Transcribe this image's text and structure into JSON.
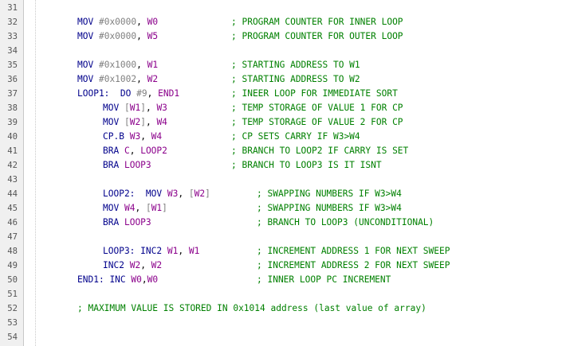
{
  "theme": {
    "comment_color": "#008000",
    "keyword_color": "#00008b",
    "register_color": "#8b008b",
    "number_color": "#808080",
    "gutter_bg": "#f0f0f0"
  },
  "editor": {
    "lines": [
      {
        "no": "31",
        "indent": 0,
        "tokens": []
      },
      {
        "no": "32",
        "indent": 0,
        "tokens": [
          {
            "t": "kw",
            "v": "MOV"
          },
          {
            "t": "txt",
            "v": " "
          },
          {
            "t": "num",
            "v": "#0x0000"
          },
          {
            "t": "txt",
            "v": ", "
          },
          {
            "t": "reg",
            "v": "W0"
          }
        ],
        "comment": "; PROGRAM COUNTER FOR INNER LOOP",
        "ccol": 290
      },
      {
        "no": "33",
        "indent": 0,
        "tokens": [
          {
            "t": "kw",
            "v": "MOV"
          },
          {
            "t": "txt",
            "v": " "
          },
          {
            "t": "num",
            "v": "#0x0000"
          },
          {
            "t": "txt",
            "v": ", "
          },
          {
            "t": "reg",
            "v": "W5"
          }
        ],
        "comment": "; PROGRAM COUNTER FOR OUTER LOOP",
        "ccol": 290
      },
      {
        "no": "34",
        "indent": 0,
        "tokens": []
      },
      {
        "no": "35",
        "indent": 0,
        "tokens": [
          {
            "t": "kw",
            "v": "MOV"
          },
          {
            "t": "txt",
            "v": " "
          },
          {
            "t": "num",
            "v": "#0x1000"
          },
          {
            "t": "txt",
            "v": ", "
          },
          {
            "t": "reg",
            "v": "W1"
          }
        ],
        "comment": "; STARTING ADDRESS TO W1",
        "ccol": 290
      },
      {
        "no": "36",
        "indent": 0,
        "tokens": [
          {
            "t": "kw",
            "v": "MOV"
          },
          {
            "t": "txt",
            "v": " "
          },
          {
            "t": "num",
            "v": "#0x1002"
          },
          {
            "t": "txt",
            "v": ", "
          },
          {
            "t": "reg",
            "v": "W2"
          }
        ],
        "comment": "; STARTING ADDRESS TO W2",
        "ccol": 290
      },
      {
        "no": "37",
        "indent": 0,
        "tokens": [
          {
            "t": "lbl",
            "v": "LOOP1:"
          },
          {
            "t": "txt",
            "v": "  "
          },
          {
            "t": "kw",
            "v": "DO"
          },
          {
            "t": "txt",
            "v": " "
          },
          {
            "t": "num",
            "v": "#9"
          },
          {
            "t": "txt",
            "v": ", "
          },
          {
            "t": "reg",
            "v": "END1"
          }
        ],
        "comment": "; INEER LOOP FOR IMMEDIATE SORT",
        "ccol": 290
      },
      {
        "no": "38",
        "indent": 1,
        "tokens": [
          {
            "t": "kw",
            "v": "MOV"
          },
          {
            "t": "txt",
            "v": " "
          },
          {
            "t": "num",
            "v": "["
          },
          {
            "t": "reg",
            "v": "W1"
          },
          {
            "t": "num",
            "v": "]"
          },
          {
            "t": "txt",
            "v": ", "
          },
          {
            "t": "reg",
            "v": "W3"
          }
        ],
        "comment": "; TEMP STORAGE OF VALUE 1 FOR CP",
        "ccol": 290
      },
      {
        "no": "39",
        "indent": 1,
        "tokens": [
          {
            "t": "kw",
            "v": "MOV"
          },
          {
            "t": "txt",
            "v": " "
          },
          {
            "t": "num",
            "v": "["
          },
          {
            "t": "reg",
            "v": "W2"
          },
          {
            "t": "num",
            "v": "]"
          },
          {
            "t": "txt",
            "v": ", "
          },
          {
            "t": "reg",
            "v": "W4"
          }
        ],
        "comment": "; TEMP STORAGE OF VALUE 2 FOR CP",
        "ccol": 290
      },
      {
        "no": "40",
        "indent": 1,
        "tokens": [
          {
            "t": "kw",
            "v": "CP.B"
          },
          {
            "t": "txt",
            "v": " "
          },
          {
            "t": "reg",
            "v": "W3"
          },
          {
            "t": "txt",
            "v": ", "
          },
          {
            "t": "reg",
            "v": "W4"
          }
        ],
        "comment": "; CP SETS CARRY IF W3>W4",
        "ccol": 290
      },
      {
        "no": "41",
        "indent": 1,
        "tokens": [
          {
            "t": "kw",
            "v": "BRA"
          },
          {
            "t": "txt",
            "v": " "
          },
          {
            "t": "reg",
            "v": "C"
          },
          {
            "t": "txt",
            "v": ", "
          },
          {
            "t": "reg",
            "v": "LOOP2"
          }
        ],
        "comment": "; BRANCH TO LOOP2 IF CARRY IS SET",
        "ccol": 290
      },
      {
        "no": "42",
        "indent": 1,
        "tokens": [
          {
            "t": "kw",
            "v": "BRA"
          },
          {
            "t": "txt",
            "v": " "
          },
          {
            "t": "reg",
            "v": "LOOP3"
          }
        ],
        "comment": "; BRANCH TO LOOP3 IS IT ISNT",
        "ccol": 290
      },
      {
        "no": "43",
        "indent": 0,
        "tokens": []
      },
      {
        "no": "44",
        "indent": 1,
        "tokens": [
          {
            "t": "lbl",
            "v": "LOOP2:"
          },
          {
            "t": "txt",
            "v": "  "
          },
          {
            "t": "kw",
            "v": "MOV"
          },
          {
            "t": "txt",
            "v": " "
          },
          {
            "t": "reg",
            "v": "W3"
          },
          {
            "t": "txt",
            "v": ", "
          },
          {
            "t": "num",
            "v": "["
          },
          {
            "t": "reg",
            "v": "W2"
          },
          {
            "t": "num",
            "v": "]"
          }
        ],
        "comment": "; SWAPPING NUMBERS IF W3>W4",
        "ccol": 322
      },
      {
        "no": "45",
        "indent": 1,
        "tokens": [
          {
            "t": "kw",
            "v": "MOV"
          },
          {
            "t": "txt",
            "v": " "
          },
          {
            "t": "reg",
            "v": "W4"
          },
          {
            "t": "txt",
            "v": ", "
          },
          {
            "t": "num",
            "v": "["
          },
          {
            "t": "reg",
            "v": "W1"
          },
          {
            "t": "num",
            "v": "]"
          }
        ],
        "comment": "; SWAPPING NUMBERS IF W3>W4",
        "ccol": 322
      },
      {
        "no": "46",
        "indent": 1,
        "tokens": [
          {
            "t": "kw",
            "v": "BRA"
          },
          {
            "t": "txt",
            "v": " "
          },
          {
            "t": "reg",
            "v": "LOOP3"
          }
        ],
        "comment": "; BRANCH TO LOOP3 (UNCONDITIONAL)",
        "ccol": 322
      },
      {
        "no": "47",
        "indent": 0,
        "tokens": []
      },
      {
        "no": "48",
        "indent": 1,
        "tokens": [
          {
            "t": "lbl",
            "v": "LOOP3:"
          },
          {
            "t": "txt",
            "v": " "
          },
          {
            "t": "kw",
            "v": "INC2"
          },
          {
            "t": "txt",
            "v": " "
          },
          {
            "t": "reg",
            "v": "W1"
          },
          {
            "t": "txt",
            "v": ", "
          },
          {
            "t": "reg",
            "v": "W1"
          }
        ],
        "comment": "; INCREMENT ADDRESS 1 FOR NEXT SWEEP",
        "ccol": 322
      },
      {
        "no": "49",
        "indent": 1,
        "tokens": [
          {
            "t": "kw",
            "v": "INC2"
          },
          {
            "t": "txt",
            "v": " "
          },
          {
            "t": "reg",
            "v": "W2"
          },
          {
            "t": "txt",
            "v": ", "
          },
          {
            "t": "reg",
            "v": "W2"
          }
        ],
        "comment": "; INCREMENT ADDRESS 2 FOR NEXT SWEEP",
        "ccol": 322
      },
      {
        "no": "50",
        "indent": 0,
        "tokens": [
          {
            "t": "lbl",
            "v": "END1:"
          },
          {
            "t": "txt",
            "v": " "
          },
          {
            "t": "kw",
            "v": "INC"
          },
          {
            "t": "txt",
            "v": " "
          },
          {
            "t": "reg",
            "v": "W0"
          },
          {
            "t": "txt",
            "v": ","
          },
          {
            "t": "reg",
            "v": "W0"
          }
        ],
        "comment": "; INNER LOOP PC INCREMENT",
        "ccol": 322
      },
      {
        "no": "51",
        "indent": 0,
        "tokens": []
      },
      {
        "no": "52",
        "indent": 0,
        "tokens": [],
        "comment": "; MAXIMUM VALUE IS STORED IN 0x1014 address (last value of array)",
        "ccol": 97
      },
      {
        "no": "53",
        "indent": 0,
        "tokens": []
      },
      {
        "no": "54",
        "indent": 0,
        "tokens": []
      }
    ]
  }
}
